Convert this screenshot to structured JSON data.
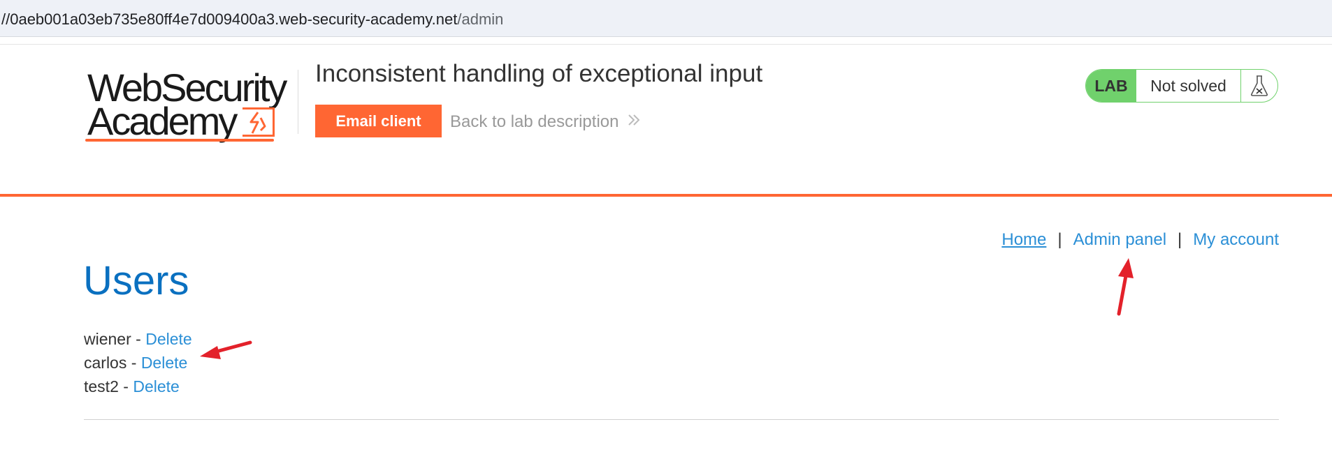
{
  "browser": {
    "url_host": "//0aeb001a03eb735e80ff4e7d009400a3.web-security-academy.net",
    "url_path": "/admin"
  },
  "header": {
    "logo_line1": "WebSecurity",
    "logo_line2": "Academy",
    "lab_title": "Inconsistent handling of exceptional input",
    "email_client_label": "Email client",
    "back_link_label": "Back to lab description",
    "lab_badge": "LAB",
    "lab_status": "Not solved"
  },
  "nav": {
    "home": "Home",
    "separator": "|",
    "admin_panel": "Admin panel",
    "my_account": "My account"
  },
  "main": {
    "heading": "Users",
    "users": [
      {
        "name": "wiener",
        "sep": " - ",
        "action": "Delete"
      },
      {
        "name": "carlos",
        "sep": " - ",
        "action": "Delete"
      },
      {
        "name": "test2",
        "sep": " - ",
        "action": "Delete"
      }
    ]
  },
  "colors": {
    "accent_orange": "#ff6633",
    "link_blue": "#2b8fd6",
    "heading_blue": "#0a70c0",
    "lab_green": "#70d16c",
    "annotation_red": "#e3212a"
  },
  "icons": {
    "lab_status_icon": "flask-icon",
    "back_icon": "double-chevron-right-icon"
  }
}
